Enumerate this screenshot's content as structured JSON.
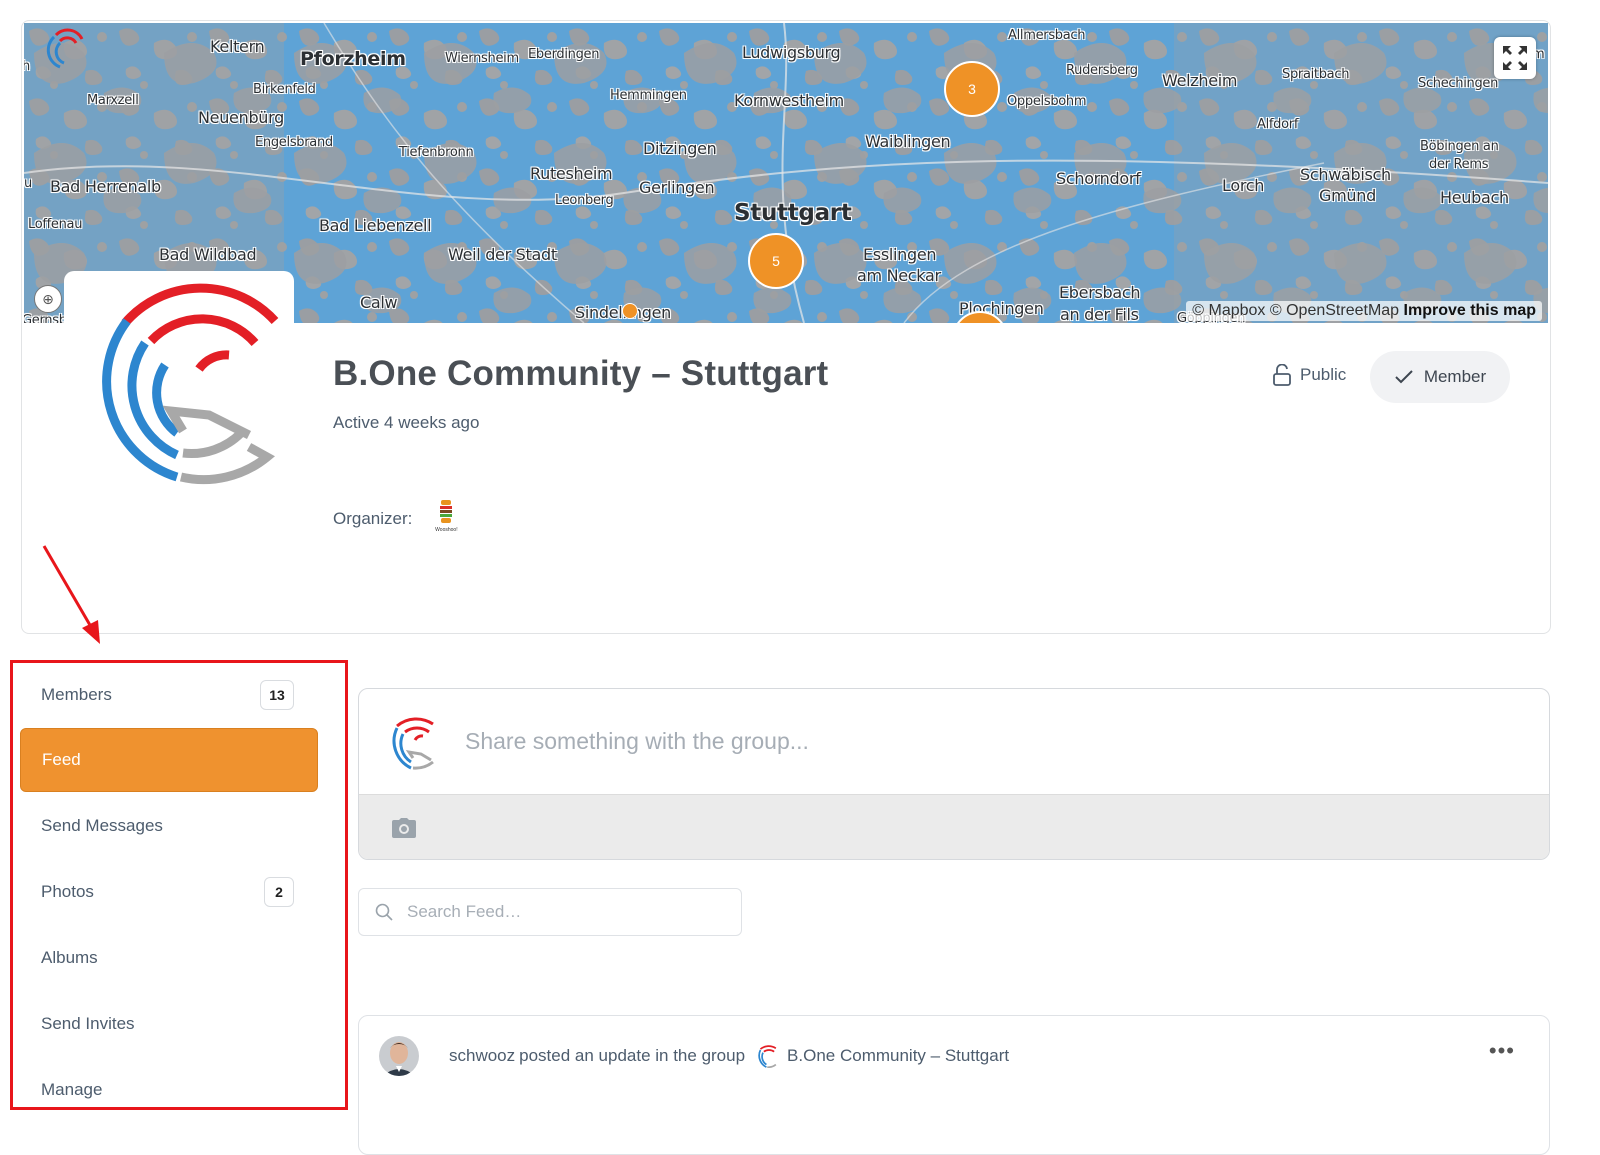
{
  "map": {
    "labels": {
      "keltern": "Keltern",
      "pforzheim": "Pforzheim",
      "wiernsheim": "Wiernsheim",
      "eberdingen": "Eberdingen",
      "ludwigsburg": "Ludwigsburg",
      "allmersbach": "Allmersbach",
      "rudersberg": "Rudersberg",
      "welzheim": "Welzheim",
      "spraitbach": "Spraitbach",
      "schechingen": "Schechingen",
      "marxzell": "Marxzell",
      "birkenfeld": "Birkenfeld",
      "neuenburg": "Neuenbürg",
      "hemmingen": "Hemmingen",
      "kornwestheim": "Kornwestheim",
      "oppelsbohm": "Oppelsbohm",
      "alfdorf": "Alfdorf",
      "engelsbrand": "Engelsbrand",
      "tiefenbronn": "Tiefenbronn",
      "ditzingen": "Ditzingen",
      "waiblingen": "Waiblingen",
      "bobingen": "Böbingen an",
      "derrems": "der Rems",
      "badherrenalb": "Bad Herrenalb",
      "rutesheim": "Rutesheim",
      "leonberg": "Leonberg",
      "gerlingen": "Gerlingen",
      "schorndorf": "Schorndorf",
      "lorch": "Lorch",
      "schwabisch": "Schwäbisch",
      "gmund": "Gmünd",
      "heubach": "Heubach",
      "loffenau": "Loffenau",
      "badliebenzell": "Bad Liebenzell",
      "stuttgart": "Stuttgart",
      "badwildbad": "Bad Wildbad",
      "weilderstadt": "Weil der Stadt",
      "esslingen": "Esslingen",
      "amneckar": "am Neckar",
      "calw": "Calw",
      "sindelfingen": "Sindelfingen",
      "plochingen": "Plochingen",
      "ebersbach": "Ebersbach",
      "anderfils": "an der Fils",
      "goppingen": "Göppingen",
      "gernsbach": "Gernsbach",
      "edge_h": "h",
      "edge_u": "u",
      "edge_m": "m"
    },
    "clusters": {
      "a": "3",
      "b": "5"
    },
    "attribution": {
      "mapbox": "© Mapbox",
      "osm": "© OpenStreetMap",
      "improve": "Improve this map"
    }
  },
  "group": {
    "title": "B.One Community – Stuttgart",
    "active": "Active 4 weeks ago",
    "organizer_label": "Organizer:",
    "organizer_avatar_text": "Wooshoo!",
    "status": "Public",
    "member_button": "Member"
  },
  "nav": {
    "items": [
      {
        "label": "Members",
        "count": "13"
      },
      {
        "label": "Feed"
      },
      {
        "label": "Send Messages"
      },
      {
        "label": "Photos",
        "count": "2"
      },
      {
        "label": "Albums"
      },
      {
        "label": "Send Invites"
      },
      {
        "label": "Manage"
      }
    ],
    "active": "Feed"
  },
  "composer": {
    "placeholder": "Share something with the group..."
  },
  "search": {
    "placeholder": "Search Feed…"
  },
  "activity": {
    "user": "schwooz",
    "action": "posted an update in the group",
    "group": "B.One Community – Stuttgart",
    "more": "•••"
  },
  "colors": {
    "accent": "#ef922f",
    "annotation": "#e8161b",
    "map_water": "#5aa0d3",
    "logo_red": "#e31f26",
    "logo_blue": "#2d86cf",
    "logo_gray": "#a8a8a8"
  },
  "icons": {
    "fullscreen": "fullscreen-icon",
    "lock": "lock-icon",
    "check": "check-icon",
    "camera": "camera-icon",
    "search": "search-icon",
    "more": "more-icon"
  }
}
